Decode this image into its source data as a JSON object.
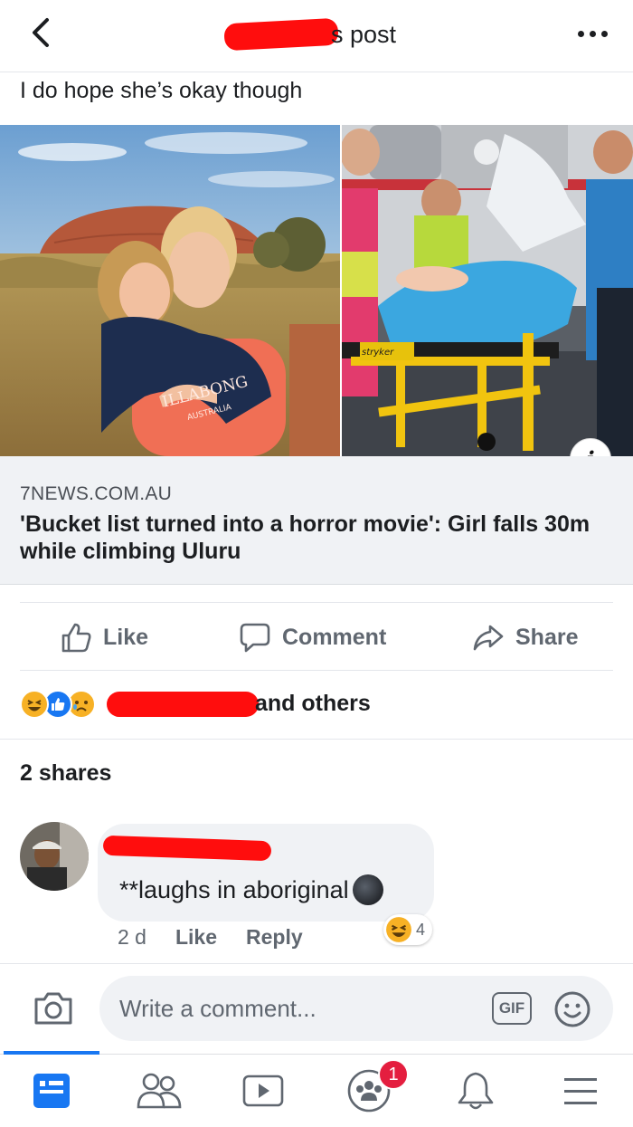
{
  "header": {
    "title_suffix": "s post"
  },
  "post": {
    "text": "I do hope she’s okay though",
    "link": {
      "domain": "7NEWS.COM.AU",
      "title": "'Bucket list turned into a horror movie': Girl falls 30m while climbing Uluru",
      "shirt_text_1": "ILLABONG",
      "shirt_text_2": "AUSTRALIA",
      "stretcher_brand": "stryker"
    }
  },
  "actions": {
    "like": "Like",
    "comment": "Comment",
    "share": "Share"
  },
  "reactions_summary": {
    "others_text": "and others"
  },
  "shares": "2 shares",
  "comment": {
    "text": "**laughs in aboriginal",
    "time": "2 d",
    "like": "Like",
    "reply": "Reply",
    "reaction_count": "4"
  },
  "composer": {
    "placeholder": "Write a comment...",
    "gif_label": "GIF"
  },
  "nav": {
    "groups_badge": "1"
  },
  "colors": {
    "brand_blue": "#1877f2",
    "redaction_red": "#ff0d0d",
    "badge_red": "#e41e3f"
  }
}
